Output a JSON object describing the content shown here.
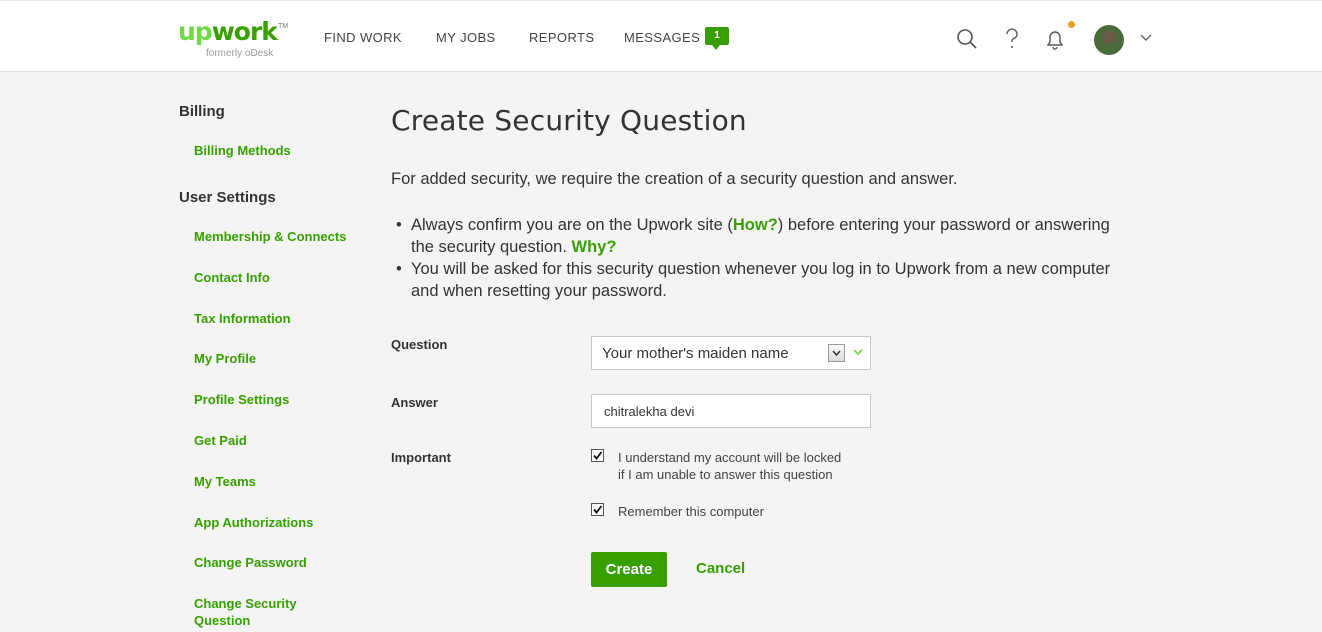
{
  "header": {
    "logo": {
      "up": "up",
      "work": "work",
      "tm": "TM",
      "subtitle": "formerly oDesk"
    },
    "nav": {
      "find_work": "FIND WORK",
      "my_jobs": "MY JOBS",
      "reports": "REPORTS",
      "messages": "MESSAGES",
      "messages_count": "1"
    },
    "icons": [
      "search-icon",
      "help-icon",
      "bell-icon",
      "avatar",
      "chevron-down-icon"
    ],
    "notification_dot_color": "#f0a021"
  },
  "sidebar": {
    "billing_heading": "Billing",
    "billing_items": [
      "Billing Methods"
    ],
    "user_settings_heading": "User Settings",
    "user_settings_items": [
      "Membership & Connects",
      "Contact Info",
      "Tax Information",
      "My Profile",
      "Profile Settings",
      "Get Paid",
      "My Teams",
      "App Authorizations",
      "Change Password",
      "Change Security Question"
    ]
  },
  "main": {
    "title": "Create Security Question",
    "intro": "For added security, we require the creation of a security question and answer.",
    "bullet1_pre": "Always confirm you are on the Upwork site (",
    "bullet1_link": "How?",
    "bullet1_mid": ") before entering your password or answering the security question. ",
    "bullet1_link2": "Why?",
    "bullet2": "You will be asked for this security question whenever you log in to Upwork from a new computer and when resetting your password.",
    "form": {
      "question_label": "Question",
      "question_value": "Your mother's maiden name",
      "answer_label": "Answer",
      "answer_value": "chitralekha devi",
      "important_label": "Important",
      "checkbox1_line1": "I understand my account will be locked",
      "checkbox1_line2": "if I am unable to answer this question",
      "checkbox1_checked": true,
      "checkbox2_label": "Remember this computer",
      "checkbox2_checked": true
    },
    "buttons": {
      "create": "Create",
      "cancel": "Cancel"
    }
  },
  "colors": {
    "brand_green": "#37a000",
    "logo_light_green": "#6fda44",
    "background": "#f4f4f4"
  }
}
